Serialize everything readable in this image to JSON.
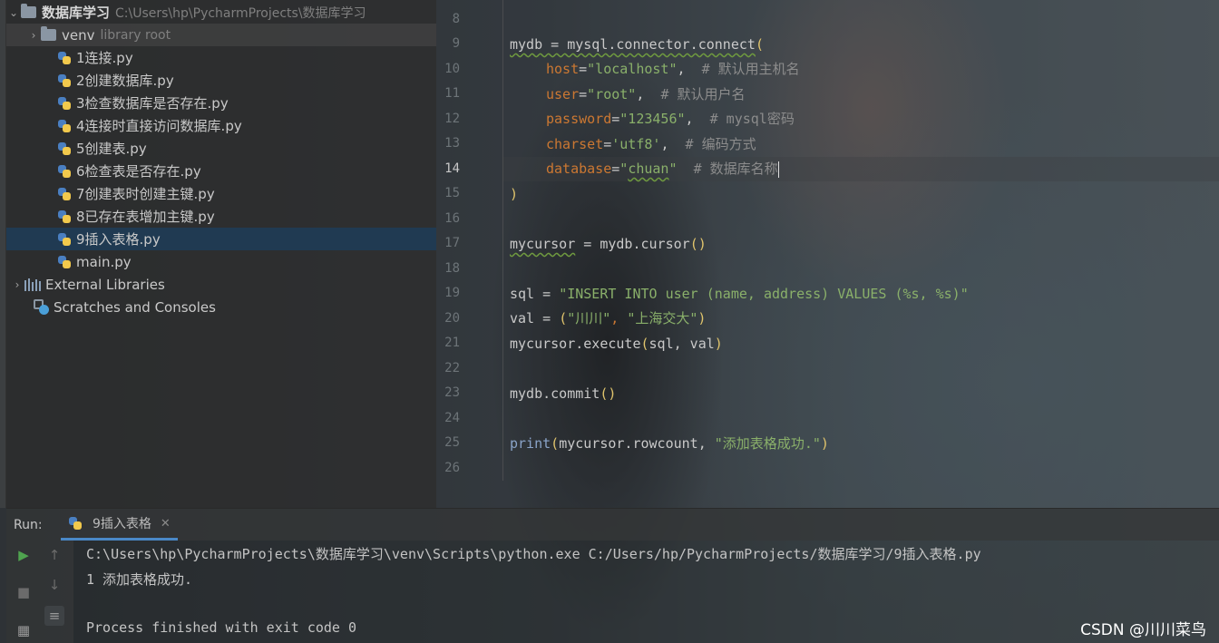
{
  "project_tree": {
    "root": {
      "name": "数据库学习",
      "path": "C:\\Users\\hp\\PycharmProjects\\数据库学习"
    },
    "venv": {
      "name": "venv",
      "note": "library root"
    },
    "files": [
      "1连接.py",
      "2创建数据库.py",
      "3检查数据库是否存在.py",
      "4连接时直接访问数据库.py",
      "5创建表.py",
      "6检查表是否存在.py",
      "7创建表时创建主键.py",
      "8已存在表增加主键.py",
      "9插入表格.py",
      "main.py"
    ],
    "selected_file": "9插入表格.py",
    "external_libraries": "External Libraries",
    "scratches": "Scratches and Consoles"
  },
  "editor": {
    "line_numbers": [
      "8",
      "9",
      "10",
      "11",
      "12",
      "13",
      "14",
      "15",
      "16",
      "17",
      "18",
      "19",
      "20",
      "21",
      "22",
      "23",
      "24",
      "25",
      "26"
    ],
    "current_line": "14",
    "code": {
      "l9": {
        "a": "mydb = mysql.connector.connect",
        "b": "("
      },
      "l10": {
        "param": "host",
        "eq": "=",
        "str": "\"localhost\"",
        "rest": ",  ",
        "cmt": "# 默认用主机名"
      },
      "l11": {
        "param": "user",
        "eq": "=",
        "str": "\"root\"",
        "rest": ",  ",
        "cmt": "# 默认用户名"
      },
      "l12": {
        "param": "password",
        "eq": "=",
        "str": "\"123456\"",
        "rest": ",  ",
        "cmt": "# mysql密码"
      },
      "l13": {
        "param": "charset",
        "eq": "=",
        "str": "'utf8'",
        "rest": ",  ",
        "cmt": "# 编码方式"
      },
      "l14": {
        "param": "database",
        "eq": "=",
        "str_q1": "\"",
        "str_w": "chuan",
        "str_q2": "\"",
        "rest": "  ",
        "cmt": "# 数据库名称"
      },
      "l15": ")",
      "l17": {
        "var": "mycursor",
        "rest": " = mydb.cursor",
        "p": "()"
      },
      "l19": {
        "a": "sql = ",
        "str": "\"INSERT INTO user (name, address) VALUES (%s, %s)\""
      },
      "l20": {
        "a": "val = ",
        "p1": "(",
        "s1": "\"川川\"",
        "c": ", ",
        "s2": "\"上海交大\"",
        "p2": ")"
      },
      "l21": {
        "a": "mycursor.execute",
        "p1": "(",
        "b": "sql, val",
        "p2": ")"
      },
      "l23": {
        "a": "mydb.commit",
        "p": "()"
      },
      "l25": {
        "fn": "print",
        "p1": "(",
        "a": "mycursor.rowcount, ",
        "str": "\"添加表格成功.\"",
        "p2": ")"
      }
    }
  },
  "run": {
    "label": "Run:",
    "tab": "9插入表格",
    "console": [
      "C:\\Users\\hp\\PycharmProjects\\数据库学习\\venv\\Scripts\\python.exe C:/Users/hp/PycharmProjects/数据库学习/9插入表格.py",
      "1 添加表格成功.",
      "",
      "Process finished with exit code 0"
    ]
  },
  "watermark": "CSDN @川川菜鸟"
}
